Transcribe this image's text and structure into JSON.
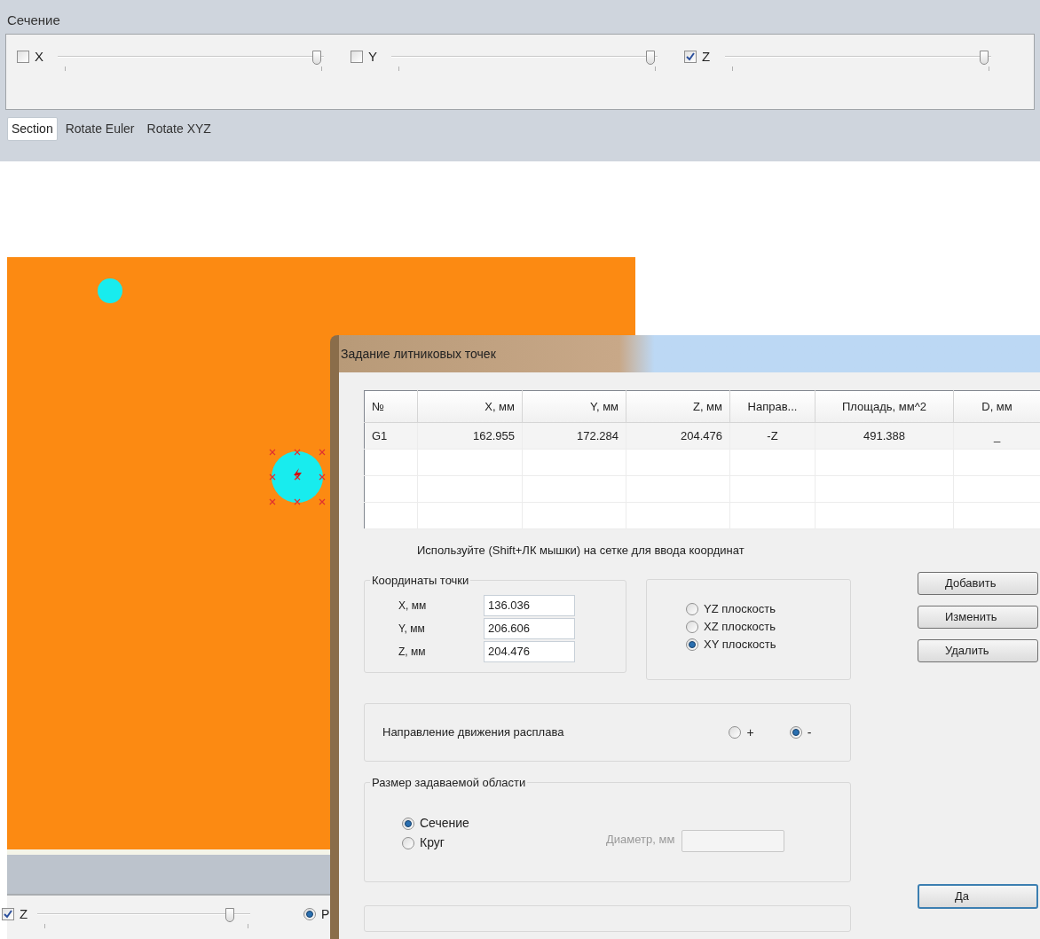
{
  "section_panel": {
    "title": "Сечение",
    "axes": [
      {
        "label": "X",
        "checked": false,
        "level": 0.99
      },
      {
        "label": "Y",
        "checked": false,
        "level": 0.99
      },
      {
        "label": "Z",
        "checked": true,
        "level": 0.99
      }
    ],
    "tabs": [
      {
        "label": "Section",
        "selected": true
      },
      {
        "label": "Rotate Euler",
        "selected": false
      },
      {
        "label": "Rotate XYZ",
        "selected": false
      }
    ]
  },
  "bottom_panel": {
    "axis": {
      "label": "Z",
      "checked": true,
      "level": 0.92
    },
    "radio": {
      "label": "Р",
      "selected": true
    }
  },
  "dialog": {
    "title": "Задание литниковых точек",
    "table": {
      "columns": [
        "№",
        "X, мм",
        "Y, мм",
        "Z, мм",
        "Направ...",
        "Площадь, мм^2",
        "D, мм"
      ],
      "rows": [
        [
          "G1",
          "162.955",
          "172.284",
          "204.476",
          "-Z",
          "491.388",
          "_"
        ]
      ]
    },
    "hint": "Используйте (Shift+ЛК мышки) на сетке для ввода координат",
    "coordinates": {
      "title": "Координаты точки",
      "fields": [
        {
          "label": "X, мм",
          "value": "136.036"
        },
        {
          "label": "Y, мм",
          "value": "206.606"
        },
        {
          "label": "Z, мм",
          "value": "204.476"
        }
      ]
    },
    "planes": [
      {
        "label": "YZ плоскость",
        "selected": false
      },
      {
        "label": "XZ плоскость",
        "selected": false
      },
      {
        "label": "XY плоскость",
        "selected": true
      }
    ],
    "buttons": [
      "Добавить",
      "Изменить",
      "Удалить"
    ],
    "direction": {
      "label": "Направление движения расплава",
      "options": [
        {
          "label": "+",
          "selected": false
        },
        {
          "label": "-",
          "selected": true
        }
      ]
    },
    "area_size": {
      "title": "Размер задаваемой области",
      "options": [
        {
          "label": "Сечение",
          "selected": true
        },
        {
          "label": "Круг",
          "selected": false
        }
      ],
      "diameter_label": "Диаметр, мм"
    },
    "ok_button": "Да"
  }
}
